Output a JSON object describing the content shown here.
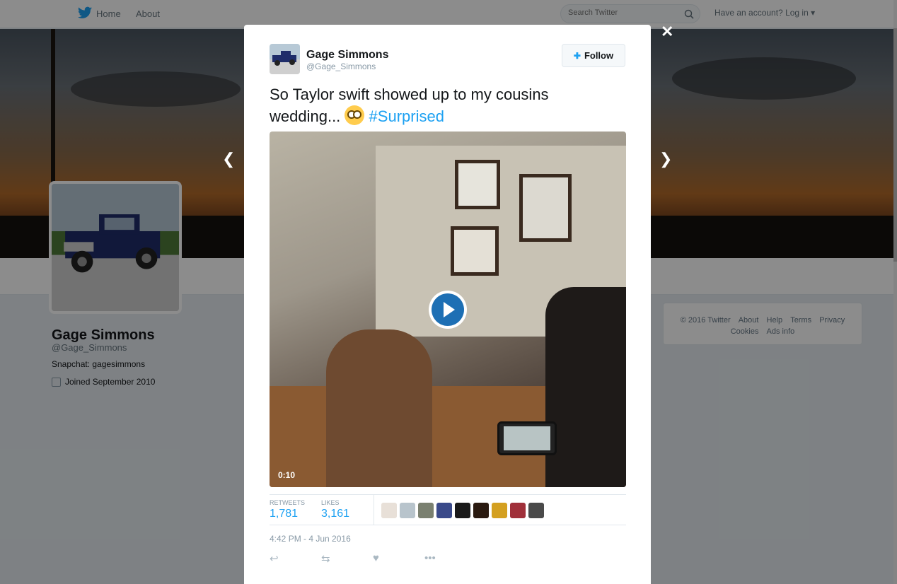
{
  "nav": {
    "home": "Home",
    "about": "About",
    "search_placeholder": "Search Twitter",
    "login": "Have an account? Log in"
  },
  "profile": {
    "name": "Gage Simmons",
    "handle": "@Gage_Simmons",
    "bio": "Snapchat: gagesimmons",
    "joined": "Joined September 2010"
  },
  "footer": {
    "links": [
      "© 2016 Twitter",
      "About",
      "Help",
      "Terms",
      "Privacy",
      "Cookies",
      "Ads info"
    ]
  },
  "modal": {
    "close": "✕",
    "author_name": "Gage Simmons",
    "author_handle": "@Gage_Simmons",
    "follow_label": "Follow",
    "text": "So Taylor swift showed up to my cousins wedding...",
    "hashtag": "#Surprised",
    "video_duration": "0:10",
    "retweets_label": "RETWEETS",
    "retweets": "1,781",
    "likes_label": "LIKES",
    "likes": "3,161",
    "timestamp": "4:42 PM - 4 Jun 2016",
    "liker_colors": [
      "#e8e0d8",
      "#b8c4cc",
      "#7a8070",
      "#3a4a8a",
      "#1a1a1a",
      "#2a1a10",
      "#d4a020",
      "#a0303a",
      "#4a4a4a"
    ]
  }
}
